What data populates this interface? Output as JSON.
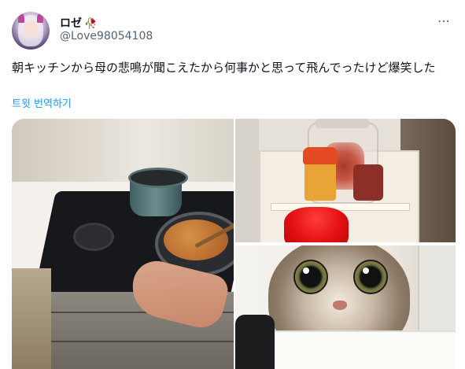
{
  "user": {
    "display_name": "ロゼ",
    "handle": "@Love98054108",
    "emoji": "🥀"
  },
  "tweet": {
    "text": "朝キッチンから母の悲鳴が聞こえたから何事かと思って飛んでったけど爆笑した",
    "translate_label": "트윗 번역하기"
  },
  "icons": {
    "more": "more-icon",
    "avatar": "avatar"
  },
  "colors": {
    "link": "#1d9bf0",
    "secondary_text": "#536471"
  }
}
